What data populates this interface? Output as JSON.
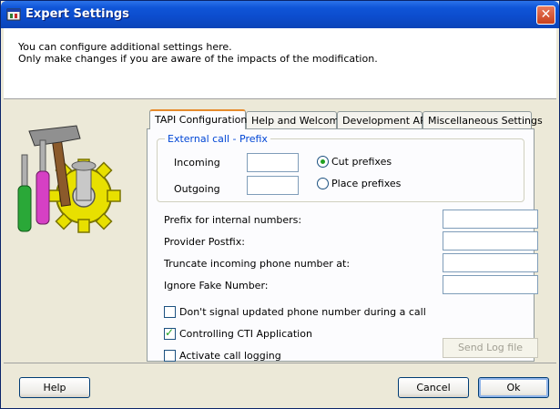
{
  "window": {
    "title": "Expert Settings",
    "close_glyph": "✕"
  },
  "header": {
    "line1": "You can configure additional settings here.",
    "line2": "Only make changes if you are aware of the impacts of the modification."
  },
  "tabs": [
    {
      "label": "TAPI Configuration",
      "active": true
    },
    {
      "label": "Help and Welcome",
      "active": false
    },
    {
      "label": "Development API",
      "active": false
    },
    {
      "label": "Miscellaneous Settings",
      "active": false
    }
  ],
  "external_prefix": {
    "title": "External call - Prefix",
    "incoming_label": "Incoming",
    "outgoing_label": "Outgoing",
    "incoming_value": "",
    "outgoing_value": "",
    "radio_cut": "Cut prefixes",
    "radio_place": "Place prefixes",
    "selected": "Cut prefixes"
  },
  "fields": {
    "prefix_internal": {
      "label": "Prefix for internal numbers:",
      "value": ""
    },
    "provider_postfix": {
      "label": "Provider Postfix:",
      "value": ""
    },
    "truncate_incoming": {
      "label": "Truncate incoming phone number at:",
      "value": ""
    },
    "ignore_fake": {
      "label": "Ignore Fake Number:",
      "value": ""
    }
  },
  "checkboxes": {
    "dont_signal": {
      "label": "Don't signal updated phone number during a call",
      "checked": false
    },
    "controlling_cti": {
      "label": "Controlling CTI Application",
      "checked": true
    },
    "activate_logging": {
      "label": "Activate call logging",
      "checked": false
    }
  },
  "send_log_label": "Send Log file",
  "buttons": {
    "help": "Help",
    "cancel": "Cancel",
    "ok": "Ok"
  },
  "colors": {
    "titlebar": "#0c4ccc",
    "group_title": "#0046d5",
    "active_tab_accent": "#e68b2c",
    "check_green": "#21a121"
  }
}
